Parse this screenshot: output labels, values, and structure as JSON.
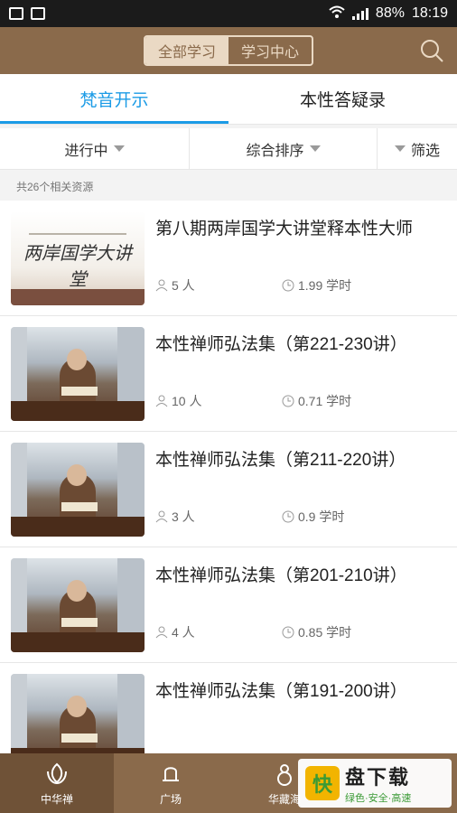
{
  "status_bar": {
    "battery": "88%",
    "time": "18:19"
  },
  "header": {
    "segments": [
      "全部学习",
      "学习中心"
    ],
    "active_segment": "全部学习"
  },
  "tabs": [
    {
      "label": "梵音开示",
      "active": true
    },
    {
      "label": "本性答疑录",
      "active": false
    }
  ],
  "filters": [
    {
      "label": "进行中"
    },
    {
      "label": "综合排序"
    },
    {
      "label": "筛选"
    }
  ],
  "result_count": "共26个相关资源",
  "items": [
    {
      "title": "第八期两岸国学大讲堂释本性大师",
      "people": "5 人",
      "hours": "1.99 学时",
      "thumb_text": "两岸国学大讲堂"
    },
    {
      "title": "本性禅师弘法集（第221-230讲）",
      "people": "10 人",
      "hours": "0.71 学时"
    },
    {
      "title": "本性禅师弘法集（第211-220讲）",
      "people": "3 人",
      "hours": "0.9 学时"
    },
    {
      "title": "本性禅师弘法集（第201-210讲）",
      "people": "4 人",
      "hours": "0.85 学时"
    },
    {
      "title": "本性禅师弘法集（第191-200讲）",
      "people": "",
      "hours": ""
    }
  ],
  "bottom_nav": [
    {
      "label": "中华禅",
      "active": true
    },
    {
      "label": "广场",
      "active": false
    },
    {
      "label": "华藏海",
      "active": false
    }
  ],
  "watermark": {
    "badge": "快",
    "main": "盘下载",
    "sub": "绿色·安全·高速"
  },
  "colors": {
    "brand_brown": "#8a6a4b",
    "tab_active_blue": "#1b9be6"
  },
  "icons": {
    "status_left": [
      "image-icon",
      "device-icon"
    ],
    "status_right": [
      "wifi-icon",
      "signal-icon"
    ],
    "search": "search-icon",
    "meta": [
      "person-icon",
      "clock-icon"
    ]
  }
}
